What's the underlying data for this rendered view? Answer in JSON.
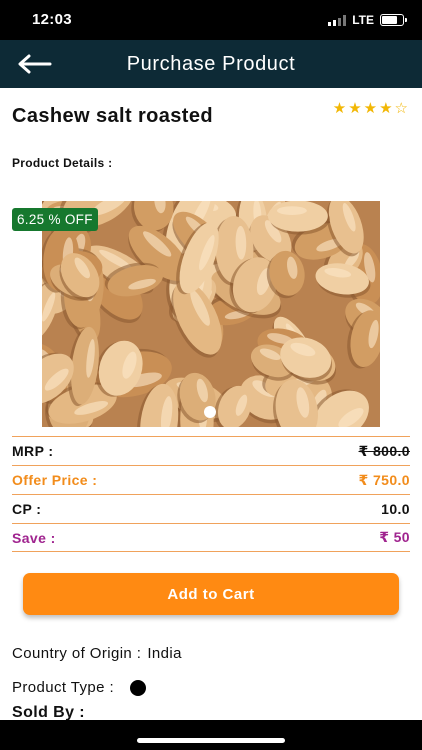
{
  "status_bar": {
    "time": "12:03",
    "network": "LTE"
  },
  "app_bar": {
    "title": "Purchase Product",
    "back_icon": "arrow-left-icon"
  },
  "product": {
    "name": "Cashew salt roasted",
    "rating": 4,
    "rating_max": 5,
    "details_label": "Product Details :",
    "discount_badge": "6.25 % OFF",
    "image_count": 1
  },
  "prices": [
    {
      "label": "MRP :",
      "value": "₹ 800.0",
      "style": "mrp"
    },
    {
      "label": "Offer Price :",
      "value": "₹ 750.0",
      "style": "offer"
    },
    {
      "label": "CP :",
      "value": "10.0",
      "style": "plain"
    },
    {
      "label": "Save :",
      "value": "₹ 50",
      "style": "save"
    }
  ],
  "cart_button": {
    "label": "Add to Cart"
  },
  "info": {
    "origin_label": "Country of Origin :",
    "origin_value": "India",
    "product_type_label": "Product Type :",
    "sold_by_label": "Sold By :"
  },
  "colors": {
    "app_bar": "#0d2a36",
    "accent": "#ff8a12",
    "offer": "#f28c1b",
    "save": "#a0248f",
    "badge": "#16782e",
    "star": "#f2b705"
  }
}
